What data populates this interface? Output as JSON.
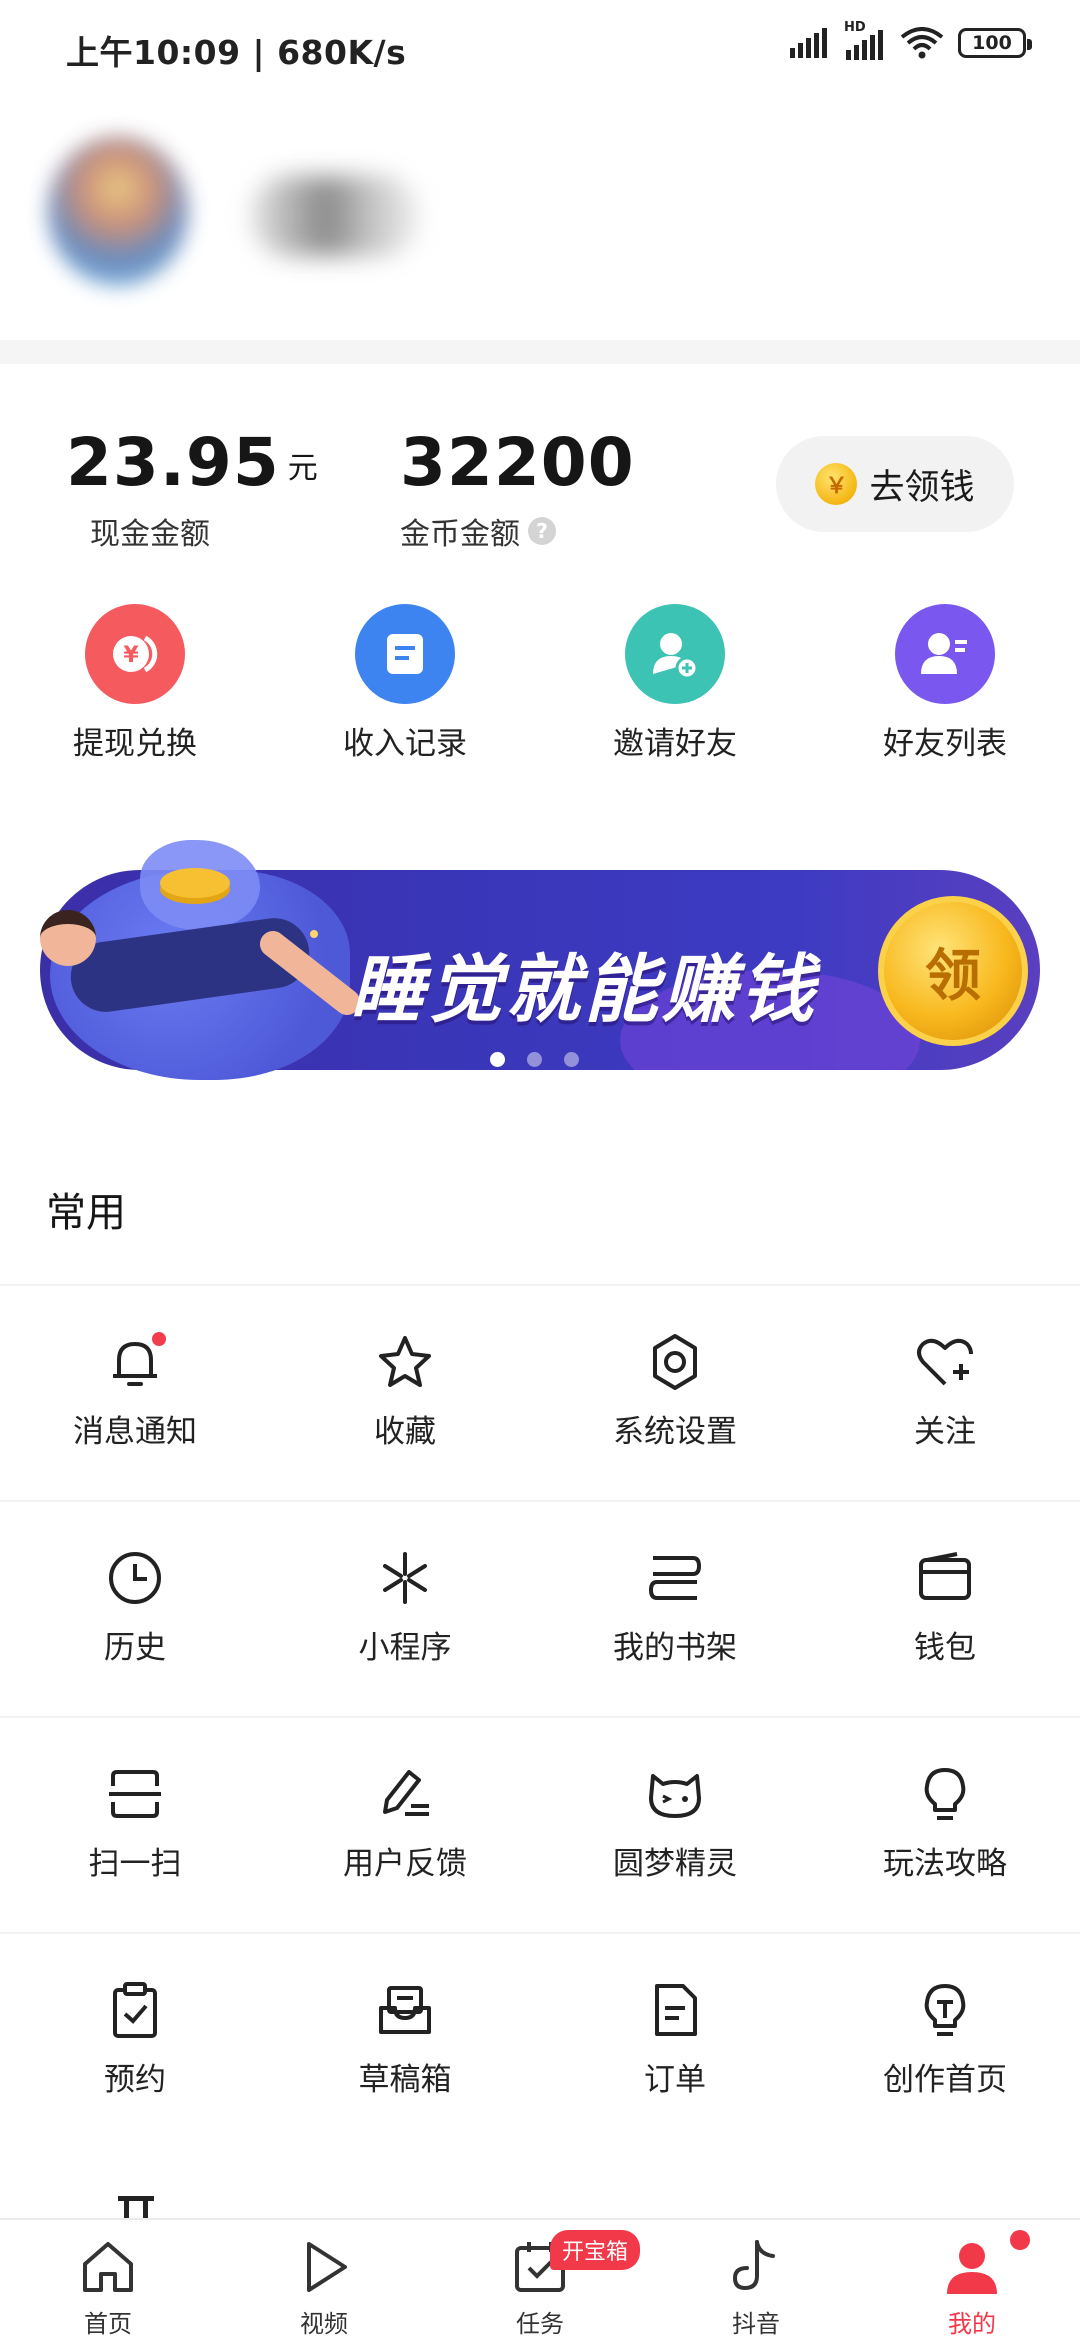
{
  "status_bar": {
    "time": "上午10:09 | 680K/s",
    "network_label": "HD",
    "battery": "100"
  },
  "balance": {
    "cash_value": "23.95",
    "cash_unit": "元",
    "cash_label": "现金金额",
    "coin_value": "32200",
    "coin_label": "金币金额",
    "claim_button": "去领钱",
    "coin_icon_char": "￥"
  },
  "quick_actions": [
    {
      "label": "提现兑换",
      "color": "#f45a5e",
      "icon": "yuan-coin-icon"
    },
    {
      "label": "收入记录",
      "color": "#3d84f0",
      "icon": "record-icon"
    },
    {
      "label": "邀请好友",
      "color": "#3cc3b3",
      "icon": "add-friend-icon"
    },
    {
      "label": "好友列表",
      "color": "#7a57ef",
      "icon": "friend-list-icon"
    }
  ],
  "banner": {
    "title": "睡觉就能赚钱",
    "coin_text": "领",
    "slides": 3,
    "active_slide": 1
  },
  "section": {
    "title": "常用"
  },
  "grid": [
    [
      {
        "label": "消息通知",
        "icon": "bell-icon"
      },
      {
        "label": "收藏",
        "icon": "star-icon"
      },
      {
        "label": "系统设置",
        "icon": "gear-icon"
      },
      {
        "label": "关注",
        "icon": "heart-plus-icon"
      }
    ],
    [
      {
        "label": "历史",
        "icon": "clock-icon"
      },
      {
        "label": "小程序",
        "icon": "mini-program-icon"
      },
      {
        "label": "我的书架",
        "icon": "bookshelf-icon"
      },
      {
        "label": "钱包",
        "icon": "wallet-icon"
      }
    ],
    [
      {
        "label": "扫一扫",
        "icon": "scan-icon"
      },
      {
        "label": "用户反馈",
        "icon": "feedback-pen-icon"
      },
      {
        "label": "圆梦精灵",
        "icon": "cat-face-icon"
      },
      {
        "label": "玩法攻略",
        "icon": "lightbulb-icon"
      }
    ],
    [
      {
        "label": "预约",
        "icon": "clipboard-check-icon"
      },
      {
        "label": "草稿箱",
        "icon": "draft-box-icon"
      },
      {
        "label": "订单",
        "icon": "order-doc-icon"
      },
      {
        "label": "创作首页",
        "icon": "creator-bulb-icon"
      }
    ]
  ],
  "bottom_nav": {
    "items": [
      {
        "label": "首页",
        "icon": "home-icon"
      },
      {
        "label": "视频",
        "icon": "play-icon"
      },
      {
        "label": "任务",
        "icon": "task-icon",
        "badge": "开宝箱"
      },
      {
        "label": "抖音",
        "icon": "douyin-icon"
      },
      {
        "label": "我的",
        "icon": "person-icon"
      }
    ],
    "active": "我的",
    "active_color": "#f2394a"
  }
}
